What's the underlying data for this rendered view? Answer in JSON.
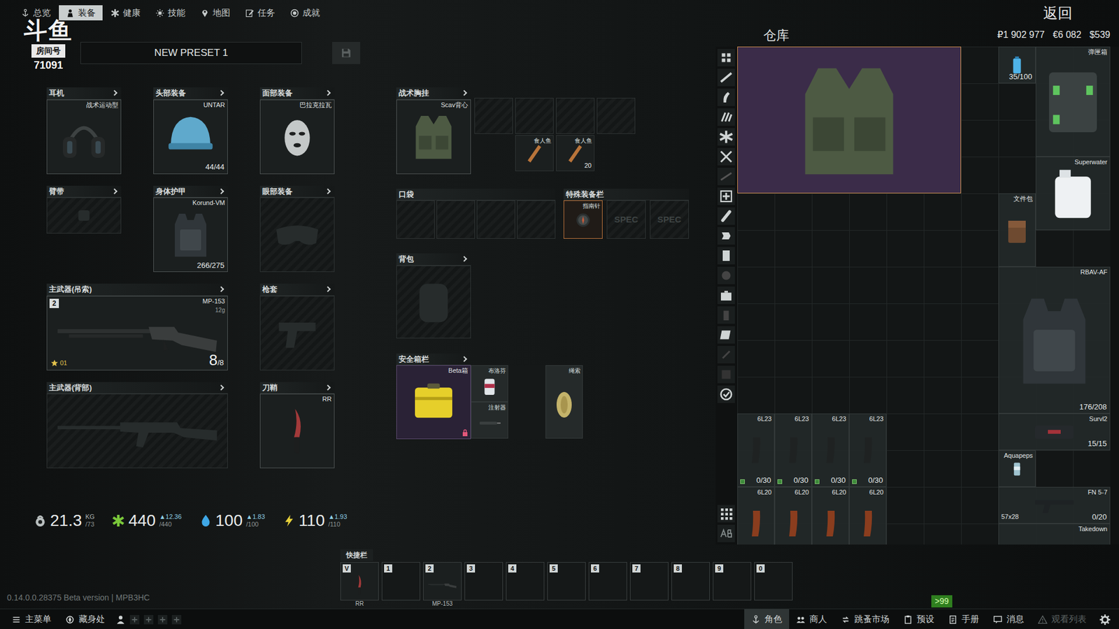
{
  "watermark": {
    "brand": "斗鱼",
    "room_label": "房间号",
    "room_number": "71091"
  },
  "top_tabs": [
    {
      "label": "总览",
      "selected": false
    },
    {
      "label": "装备",
      "selected": true
    },
    {
      "label": "健康",
      "selected": false
    },
    {
      "label": "技能",
      "selected": false
    },
    {
      "label": "地图",
      "selected": false
    },
    {
      "label": "任务",
      "selected": false
    },
    {
      "label": "成就",
      "selected": false
    }
  ],
  "back_button": "返回",
  "preset": {
    "name": "NEW PRESET 1"
  },
  "slots": [
    {
      "kind": "headset",
      "title": "耳机",
      "item": "战术运动型",
      "filled": true
    },
    {
      "kind": "helmet",
      "title": "头部装备",
      "item": "UNTAR",
      "reading": "44/44",
      "filled": true
    },
    {
      "kind": "mask",
      "title": "面部装备",
      "item": "巴拉克拉瓦",
      "filled": true
    },
    {
      "kind": "armband",
      "title": "臂带",
      "filled": false
    },
    {
      "kind": "armor",
      "title": "身体护甲",
      "item": "Korund-VM",
      "reading": "266/275",
      "filled": true
    },
    {
      "kind": "goggles",
      "title": "眼部装备",
      "filled": false
    },
    {
      "kind": "shotgun",
      "title": "主武器(吊索)",
      "item": "MP-153",
      "caliber": "12g",
      "number": "2",
      "ammo": "8",
      "ammo_max": "/8",
      "rank": "01",
      "filled": true
    },
    {
      "kind": "holster",
      "title": "枪套",
      "filled": false
    },
    {
      "kind": "rifle",
      "title": "主武器(背部)",
      "filled": false
    },
    {
      "kind": "knife",
      "title": "刀鞘",
      "item": "RR",
      "filled": true
    }
  ],
  "stats": [
    {
      "kind": "weight",
      "value": "21.3",
      "unit": "KG",
      "max": "/73"
    },
    {
      "kind": "health",
      "value": "440",
      "delta": "▲12.36",
      "max": "/440"
    },
    {
      "kind": "hydration",
      "value": "100",
      "delta": "▲1.83",
      "max": "/100"
    },
    {
      "kind": "energy",
      "value": "110",
      "delta": "▲1.93",
      "max": "/110"
    }
  ],
  "rig": {
    "title": "战术胸挂",
    "item": "Scav背心",
    "cells": [
      {
        "filled": false
      },
      {
        "filled": false
      },
      {
        "filled": false
      },
      {
        "filled": false
      },
      {
        "item": "食人鱼",
        "filled": true
      },
      {
        "item": "食人鱼",
        "count": "20",
        "filled": true
      }
    ]
  },
  "pockets": {
    "title": "口袋",
    "cells": [
      {
        "filled": false
      },
      {
        "filled": false
      },
      {
        "filled": false
      },
      {
        "filled": false
      }
    ]
  },
  "special": {
    "title": "特殊装备栏",
    "cells": [
      {
        "label": "指南针",
        "filled": true
      },
      {
        "label": "SPEC",
        "filled": false
      },
      {
        "label": "SPEC",
        "filled": false
      }
    ]
  },
  "backpack": {
    "title": "背包",
    "filled": false
  },
  "secure": {
    "title": "安全箱栏",
    "item": "Beta箱",
    "contents": [
      {
        "kind": "pill",
        "label": "布洛芬"
      },
      {
        "kind": "syringe",
        "label": "注射器"
      },
      {
        "kind": "rope",
        "label": "绳索"
      }
    ]
  },
  "stash": {
    "title": "仓库",
    "currencies": [
      "₽1 902 977",
      "€6 082",
      "$539"
    ],
    "items": [
      {
        "kind": "vest",
        "highlighted": true
      },
      {
        "kind": "bottle",
        "reading": "35/100",
        "highlighted": false
      },
      {
        "kind": "case",
        "label": "弹匣箱",
        "highlighted": false
      },
      {
        "kind": "jug",
        "label": "Superwater",
        "highlighted": false
      },
      {
        "kind": "bag",
        "label": "文件包",
        "highlighted": false
      },
      {
        "kind": "armor",
        "label": "RBAV-AF",
        "reading": "176/208",
        "highlighted": false
      },
      {
        "kind": "kit",
        "label": "Survl2",
        "reading": "15/15",
        "highlighted": false
      },
      {
        "kind": "can",
        "label": "Aquapeps",
        "highlighted": false
      },
      {
        "kind": "pistol",
        "label": "FN 5-7",
        "caliber": "57x28",
        "reading": "0/20",
        "highlighted": false
      },
      {
        "kind": "pack",
        "label": "Takedown",
        "highlighted": false
      },
      {
        "kind": "mag",
        "label": "6L23",
        "reading": "0/30",
        "highlighted": false
      },
      {
        "kind": "mag",
        "label": "6L23",
        "reading": "0/30",
        "highlighted": false
      },
      {
        "kind": "mag",
        "label": "6L23",
        "reading": "0/30",
        "highlighted": false
      },
      {
        "kind": "mag",
        "label": "6L23",
        "reading": "0/30",
        "highlighted": false
      },
      {
        "kind": "bakelite",
        "label": "6L20",
        "highlighted": false
      },
      {
        "kind": "bakelite",
        "label": "6L20",
        "highlighted": false
      },
      {
        "kind": "bakelite",
        "label": "6L20",
        "highlighted": false
      },
      {
        "kind": "bakelite",
        "label": "6L20",
        "highlighted": false
      }
    ]
  },
  "quickbar": {
    "title": "快捷栏",
    "slots": [
      {
        "key": "V",
        "item": "RR",
        "filled": true
      },
      {
        "key": "1",
        "filled": false
      },
      {
        "key": "2",
        "item": "MP-153",
        "filled": true
      },
      {
        "key": "3",
        "filled": false
      },
      {
        "key": "4",
        "filled": false
      },
      {
        "key": "5",
        "filled": false
      },
      {
        "key": "6",
        "filled": false
      },
      {
        "key": "7",
        "filled": false
      },
      {
        "key": "8",
        "filled": false
      },
      {
        "key": "9",
        "filled": false
      },
      {
        "key": "0",
        "filled": false
      }
    ]
  },
  "version": "0.14.0.0.28375 Beta version | MPB3HC",
  "notification_badge": ">99",
  "bottom_bar": {
    "left": [
      {
        "label": "主菜单"
      },
      {
        "label": "藏身处"
      }
    ],
    "tabs": [
      {
        "label": "角色",
        "selected": true,
        "disabled": false
      },
      {
        "label": "商人",
        "selected": false,
        "disabled": false
      },
      {
        "label": "跳蚤市场",
        "selected": false,
        "disabled": false
      },
      {
        "label": "预设",
        "selected": false,
        "disabled": false
      },
      {
        "label": "手册",
        "selected": false,
        "disabled": false
      },
      {
        "label": "消息",
        "selected": false,
        "disabled": false
      },
      {
        "label": "观看列表",
        "selected": false,
        "disabled": true
      }
    ]
  }
}
